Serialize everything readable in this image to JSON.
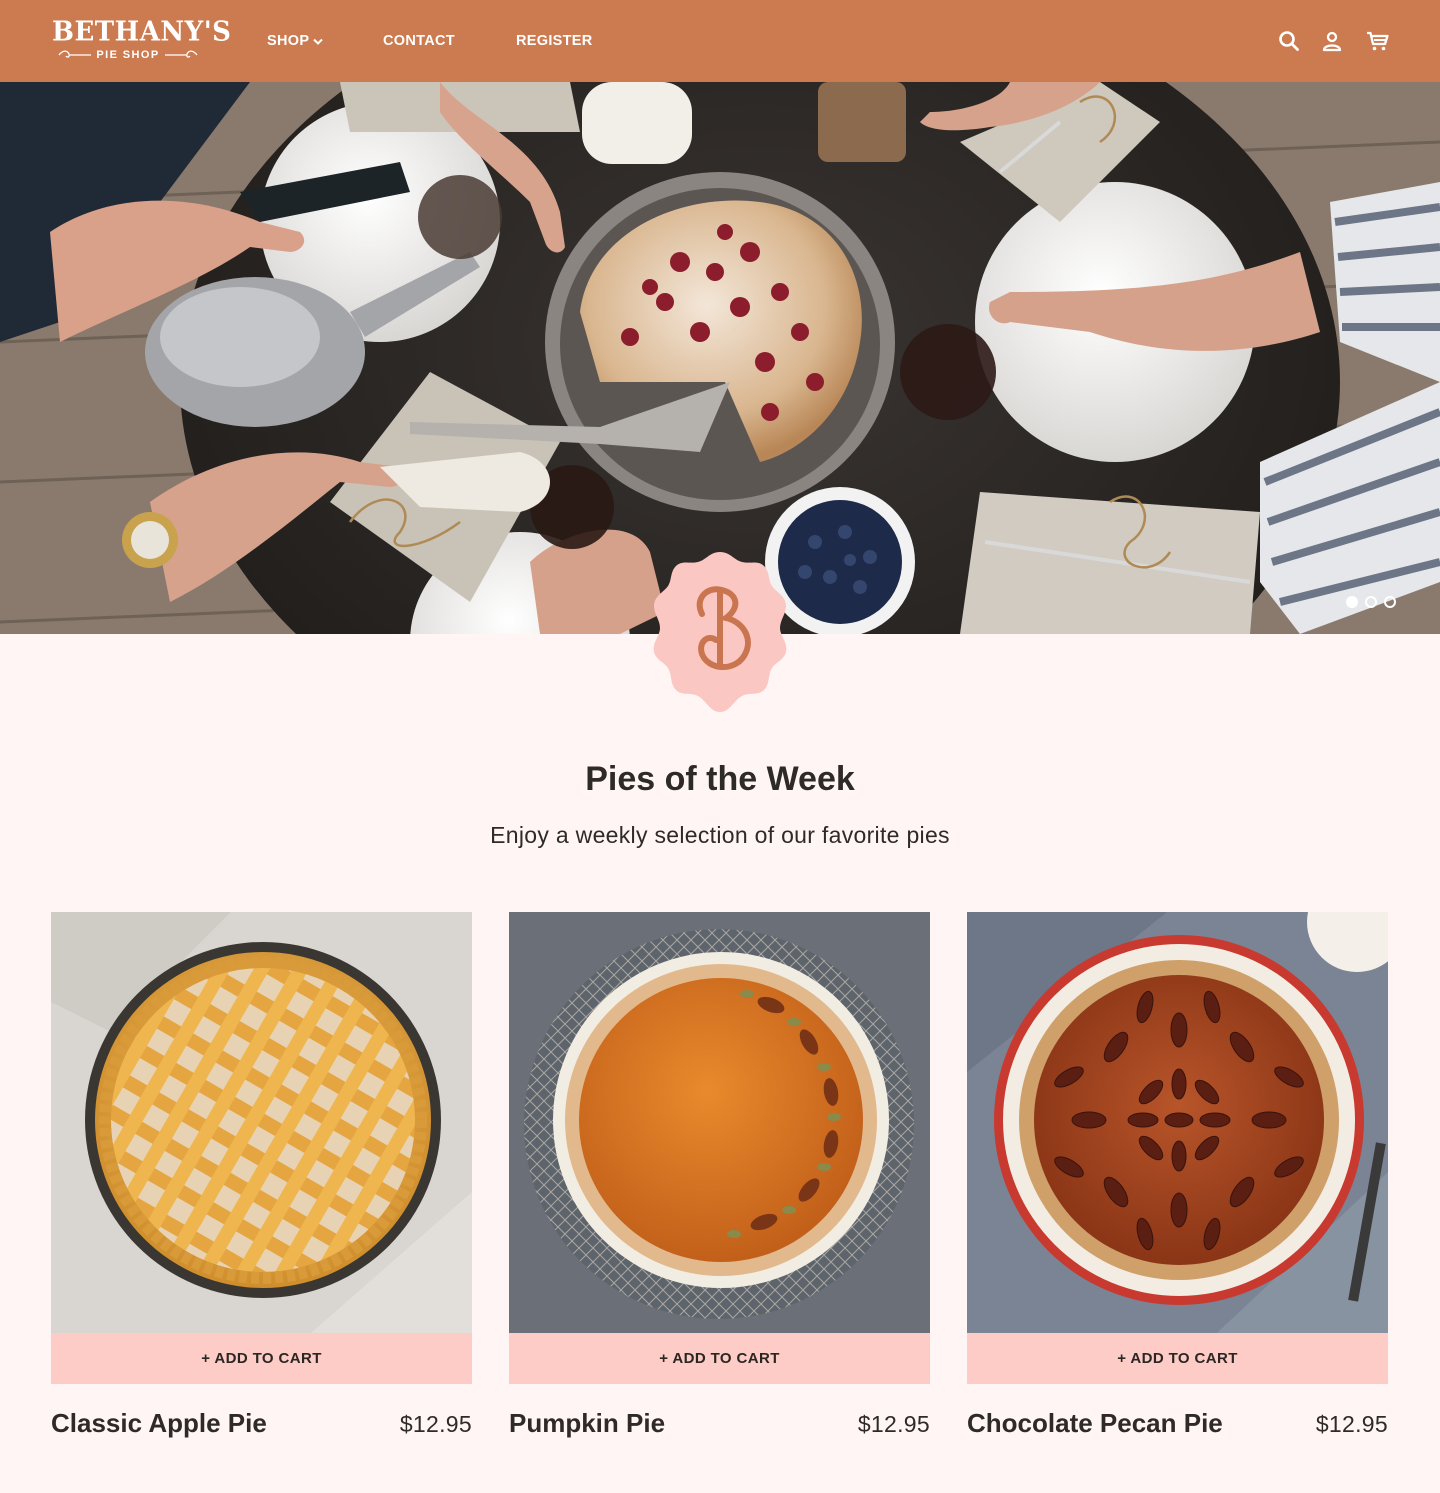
{
  "header": {
    "logo_main": "BETHANY'S",
    "logo_sub": "PIE SHOP",
    "nav": [
      {
        "label": "SHOP"
      },
      {
        "label": "CONTACT"
      },
      {
        "label": "REGISTER"
      }
    ],
    "icons": [
      "search-icon",
      "user-icon",
      "cart-icon"
    ]
  },
  "hero": {
    "slides": 3,
    "active_slide": 1
  },
  "section": {
    "title": "Pies of the Week",
    "subtitle": "Enjoy a weekly selection of our favorite pies"
  },
  "products": [
    {
      "name": "Classic Apple Pie",
      "price": "$12.95",
      "button": "+ ADD TO CART"
    },
    {
      "name": "Pumpkin Pie",
      "price": "$12.95",
      "button": "+ ADD TO CART"
    },
    {
      "name": "Chocolate Pecan Pie",
      "price": "$12.95",
      "button": "+ ADD TO CART"
    }
  ],
  "colors": {
    "header_bg": "#cc7b50",
    "page_bg": "#fff5f4",
    "button_bg": "#fdccc6",
    "badge_bg": "#fbc7c2",
    "text": "#2e2a27"
  }
}
